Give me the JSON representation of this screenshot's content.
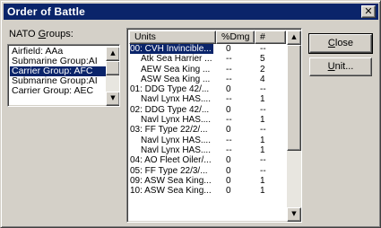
{
  "window": {
    "title": "Order of Battle",
    "close_glyph": "✕"
  },
  "groups": {
    "label_prefix": "NATO ",
    "label_mnemonic": "G",
    "label_suffix": "roups:",
    "items": [
      {
        "label": "Airfield:   AAa",
        "selected": false
      },
      {
        "label": "Submarine Group:AI",
        "selected": false
      },
      {
        "label": "Carrier Group:  AFC",
        "selected": true
      },
      {
        "label": "Submarine Group:AI",
        "selected": false
      },
      {
        "label": "Carrier Group:  AEC",
        "selected": false
      }
    ]
  },
  "units": {
    "columns": [
      "Units",
      "%Dmg",
      "#"
    ],
    "rows": [
      {
        "name": "00: CVH Invincible...",
        "dmg": "0",
        "count": "--",
        "indent": false,
        "selected": true
      },
      {
        "name": "Atk  Sea Harrier ...",
        "dmg": "--",
        "count": "5",
        "indent": true,
        "selected": false
      },
      {
        "name": "AEW  Sea King ...",
        "dmg": "--",
        "count": "2",
        "indent": true,
        "selected": false
      },
      {
        "name": "ASW  Sea King ...",
        "dmg": "--",
        "count": "4",
        "indent": true,
        "selected": false
      },
      {
        "name": "01: DDG Type 42/...",
        "dmg": "0",
        "count": "--",
        "indent": false,
        "selected": false
      },
      {
        "name": "Navl Lynx HAS....",
        "dmg": "--",
        "count": "1",
        "indent": true,
        "selected": false
      },
      {
        "name": "02: DDG Type 42/...",
        "dmg": "0",
        "count": "--",
        "indent": false,
        "selected": false
      },
      {
        "name": "Navl Lynx HAS....",
        "dmg": "--",
        "count": "1",
        "indent": true,
        "selected": false
      },
      {
        "name": "03: FF Type 22/2/...",
        "dmg": "0",
        "count": "--",
        "indent": false,
        "selected": false
      },
      {
        "name": "Navl Lynx HAS....",
        "dmg": "--",
        "count": "1",
        "indent": true,
        "selected": false
      },
      {
        "name": "Navl Lynx HAS....",
        "dmg": "--",
        "count": "1",
        "indent": true,
        "selected": false
      },
      {
        "name": "04: AO Fleet Oiler/...",
        "dmg": "0",
        "count": "--",
        "indent": false,
        "selected": false
      },
      {
        "name": "05: FF Type 22/3/...",
        "dmg": "0",
        "count": "--",
        "indent": false,
        "selected": false
      },
      {
        "name": "09: ASW Sea King...",
        "dmg": "0",
        "count": "1",
        "indent": false,
        "selected": false
      },
      {
        "name": "10: ASW Sea King...",
        "dmg": "0",
        "count": "1",
        "indent": false,
        "selected": false
      }
    ]
  },
  "buttons": {
    "close_mnemonic": "C",
    "close_rest": "lose",
    "unit_mnemonic": "U",
    "unit_rest": "nit..."
  },
  "scroll_arrows": {
    "up": "▲",
    "down": "▼"
  }
}
